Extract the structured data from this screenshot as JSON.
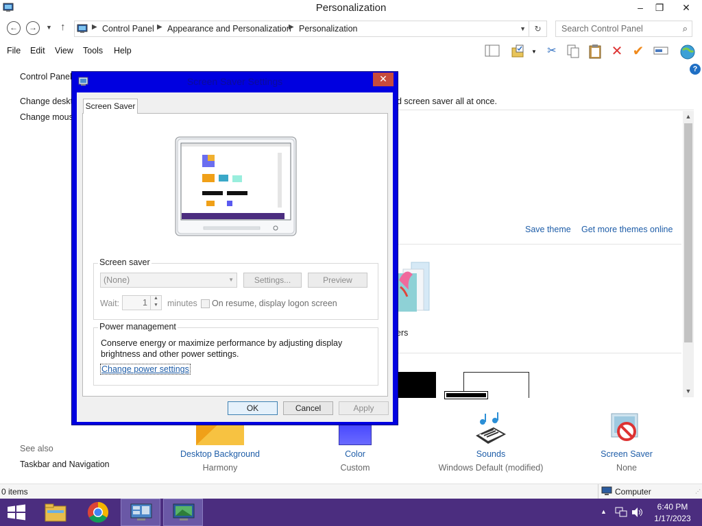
{
  "window": {
    "title": "Personalization",
    "minimize": "–",
    "restore": "❐",
    "close": "✕"
  },
  "nav": {
    "back": "←",
    "forward": "→",
    "up": "↑",
    "breadcrumbs": [
      "Control Panel",
      "Appearance and Personalization",
      "Personalization"
    ],
    "search_placeholder": "Search Control Panel"
  },
  "menu": [
    "File",
    "Edit",
    "View",
    "Tools",
    "Help"
  ],
  "background": {
    "sidebar_home": "Control Panel",
    "sidebar_links": [
      "Change deskto",
      "Change mous"
    ],
    "heading_tail": "d screen saver all at once.",
    "save_theme": "Save theme",
    "get_more": "Get more themes online",
    "partial_label": "ers",
    "see_also": "See also",
    "see_also_link": "Taskbar and Navigation",
    "bottom_items": [
      {
        "label": "Desktop Background",
        "sub": "Harmony"
      },
      {
        "label": "Color",
        "sub": "Custom"
      },
      {
        "label": "Sounds",
        "sub": "Windows Default (modified)"
      },
      {
        "label": "Screen Saver",
        "sub": "None"
      }
    ]
  },
  "status": {
    "items": "0 items",
    "location": "Computer"
  },
  "taskbar": {
    "time": "6:40 PM",
    "date": "1/17/2023"
  },
  "dialog": {
    "title": "Screen Saver Settings",
    "close": "✕",
    "tab": "Screen Saver",
    "screen_saver_group": "Screen saver",
    "select_value": "(None)",
    "settings_btn": "Settings...",
    "preview_btn": "Preview",
    "wait_label": "Wait:",
    "wait_value": "1",
    "minutes_label": "minutes",
    "resume_label": "On resume, display logon screen",
    "power_group": "Power management",
    "power_text_1": "Conserve energy or maximize performance by adjusting display",
    "power_text_2": "brightness and other power settings.",
    "power_link": "Change power settings",
    "ok": "OK",
    "cancel": "Cancel",
    "apply": "Apply"
  },
  "colors": {
    "dialog_frame": "#0000e0",
    "taskbar": "#4b2d7f",
    "link": "#1e5da8"
  }
}
